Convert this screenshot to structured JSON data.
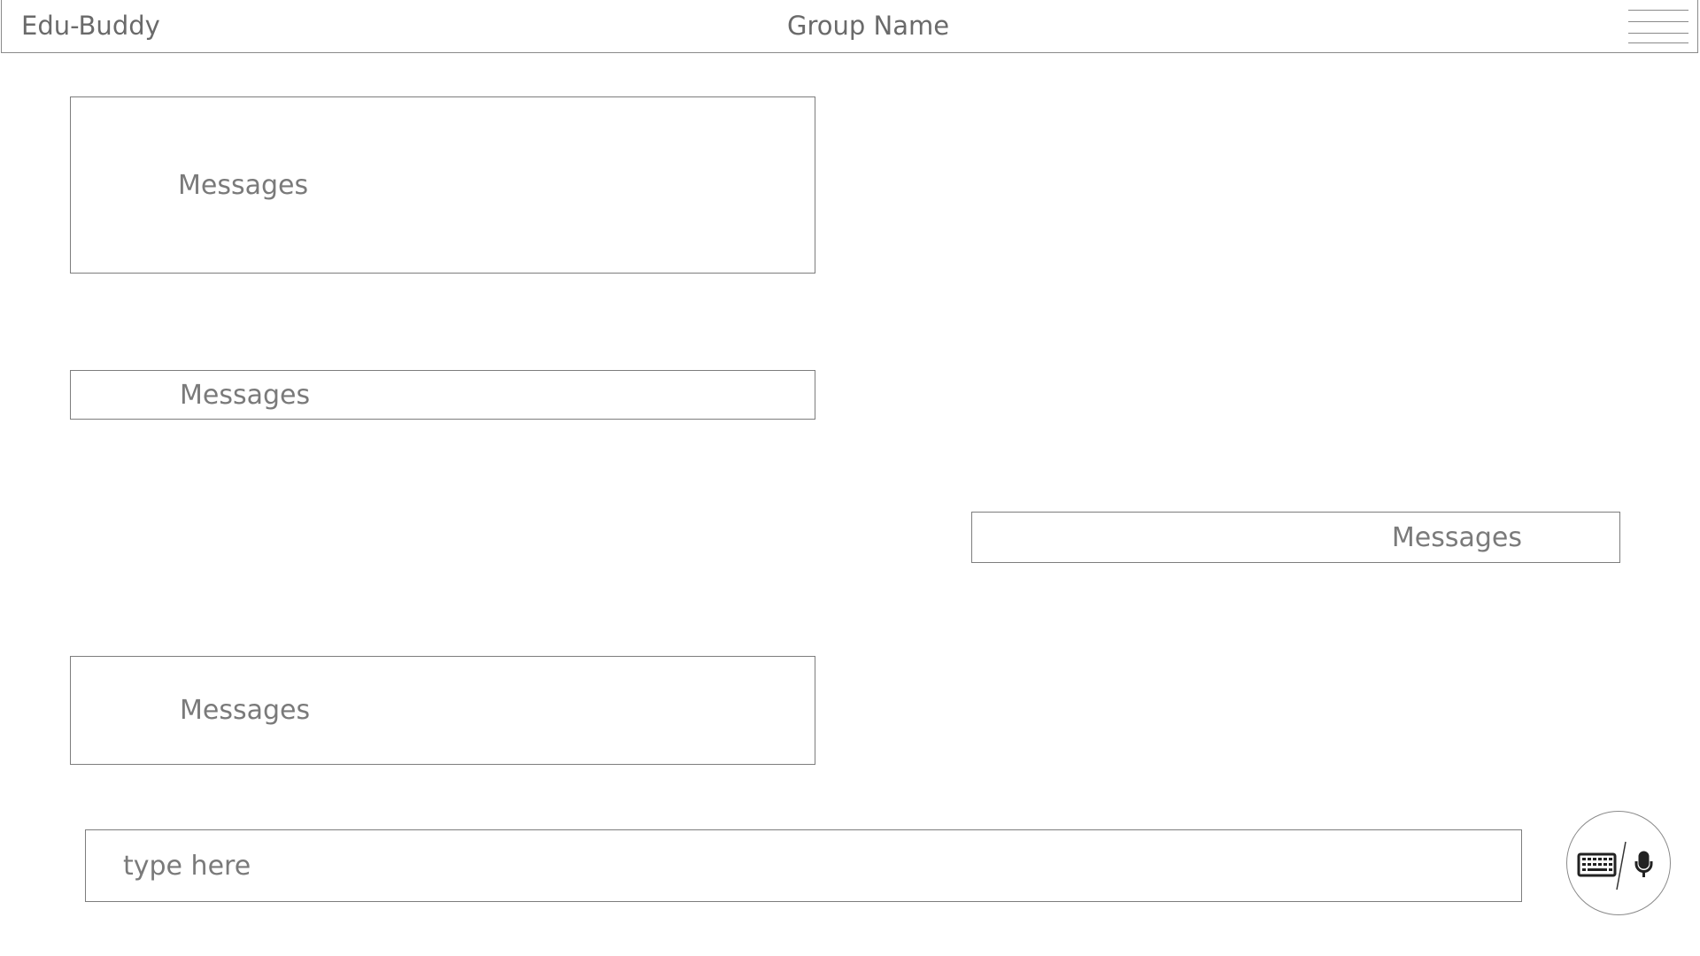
{
  "header": {
    "app_title": "Edu-Buddy",
    "group_name": "Group Name",
    "menu_icon": "hamburger-menu-icon"
  },
  "messages": [
    {
      "side": "left",
      "text": "Messages"
    },
    {
      "side": "left",
      "text": "Messages"
    },
    {
      "side": "right",
      "text": "Messages"
    },
    {
      "side": "left",
      "text": "Messages"
    }
  ],
  "composer": {
    "placeholder": "type here",
    "value": ""
  },
  "input_mode": {
    "icons": [
      "keyboard-icon",
      "microphone-icon"
    ]
  },
  "colors": {
    "border": "#7d7d7d",
    "text": "#6f6f6f",
    "background": "#ffffff"
  }
}
